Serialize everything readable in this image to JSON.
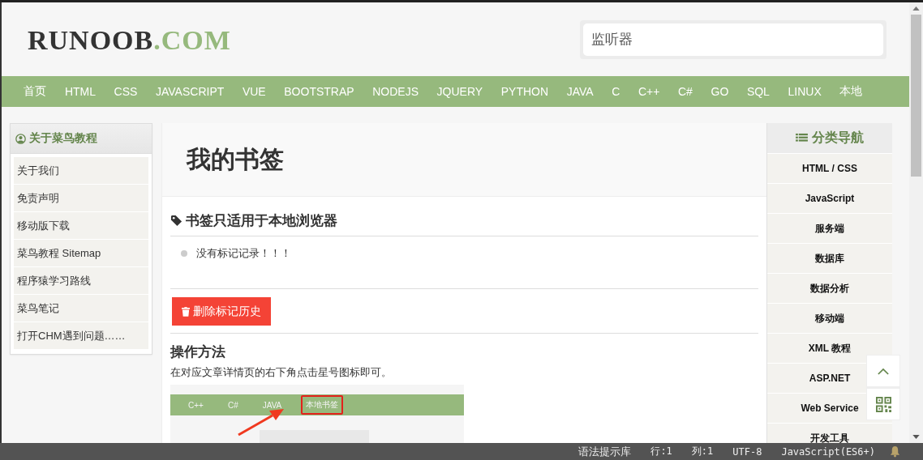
{
  "logo": {
    "text": "RUNOOB",
    "suffix": ".COM"
  },
  "search": {
    "value": "监听器"
  },
  "nav": [
    "首页",
    "HTML",
    "CSS",
    "JAVASCRIPT",
    "VUE",
    "BOOTSTRAP",
    "NODEJS",
    "JQUERY",
    "PYTHON",
    "JAVA",
    "C",
    "C++",
    "C#",
    "GO",
    "SQL",
    "LINUX",
    "本地"
  ],
  "sidebar": {
    "title": "关于菜鸟教程",
    "items": [
      "关于我们",
      "免责声明",
      "移动版下载",
      "菜鸟教程 Sitemap",
      "程序猿学习路线",
      "菜鸟笔记",
      "打开CHM遇到问题……"
    ]
  },
  "page_title": "我的书签",
  "bookmarks": {
    "heading": "书签只适用于本地浏览器",
    "items": [
      "没有标记记录！！！"
    ],
    "clear_button": "删除标记历史"
  },
  "howto": {
    "heading": "操作方法",
    "text": "在对应文章详情页的右下角点击星号图标即可。",
    "example": {
      "nav": [
        {
          "label": "C++",
          "highlighted": false
        },
        {
          "label": "C#",
          "highlighted": false
        },
        {
          "label": "JAVA",
          "highlighted": false
        },
        {
          "label": "本地书签",
          "highlighted": true
        }
      ]
    }
  },
  "category_nav": {
    "title": "分类导航",
    "items": [
      "HTML / CSS",
      "JavaScript",
      "服务端",
      "数据库",
      "数据分析",
      "移动端",
      "XML 教程",
      "ASP.NET",
      "Web Service",
      "开发工具"
    ]
  },
  "status_bar": [
    {
      "label": "语法提示库",
      "kind": "label"
    },
    {
      "label": "行:1",
      "kind": "code"
    },
    {
      "label": "列:1",
      "kind": "code"
    },
    {
      "label": "UTF-8",
      "kind": "code"
    },
    {
      "label": "JavaScript(ES6+)",
      "kind": "code"
    }
  ]
}
